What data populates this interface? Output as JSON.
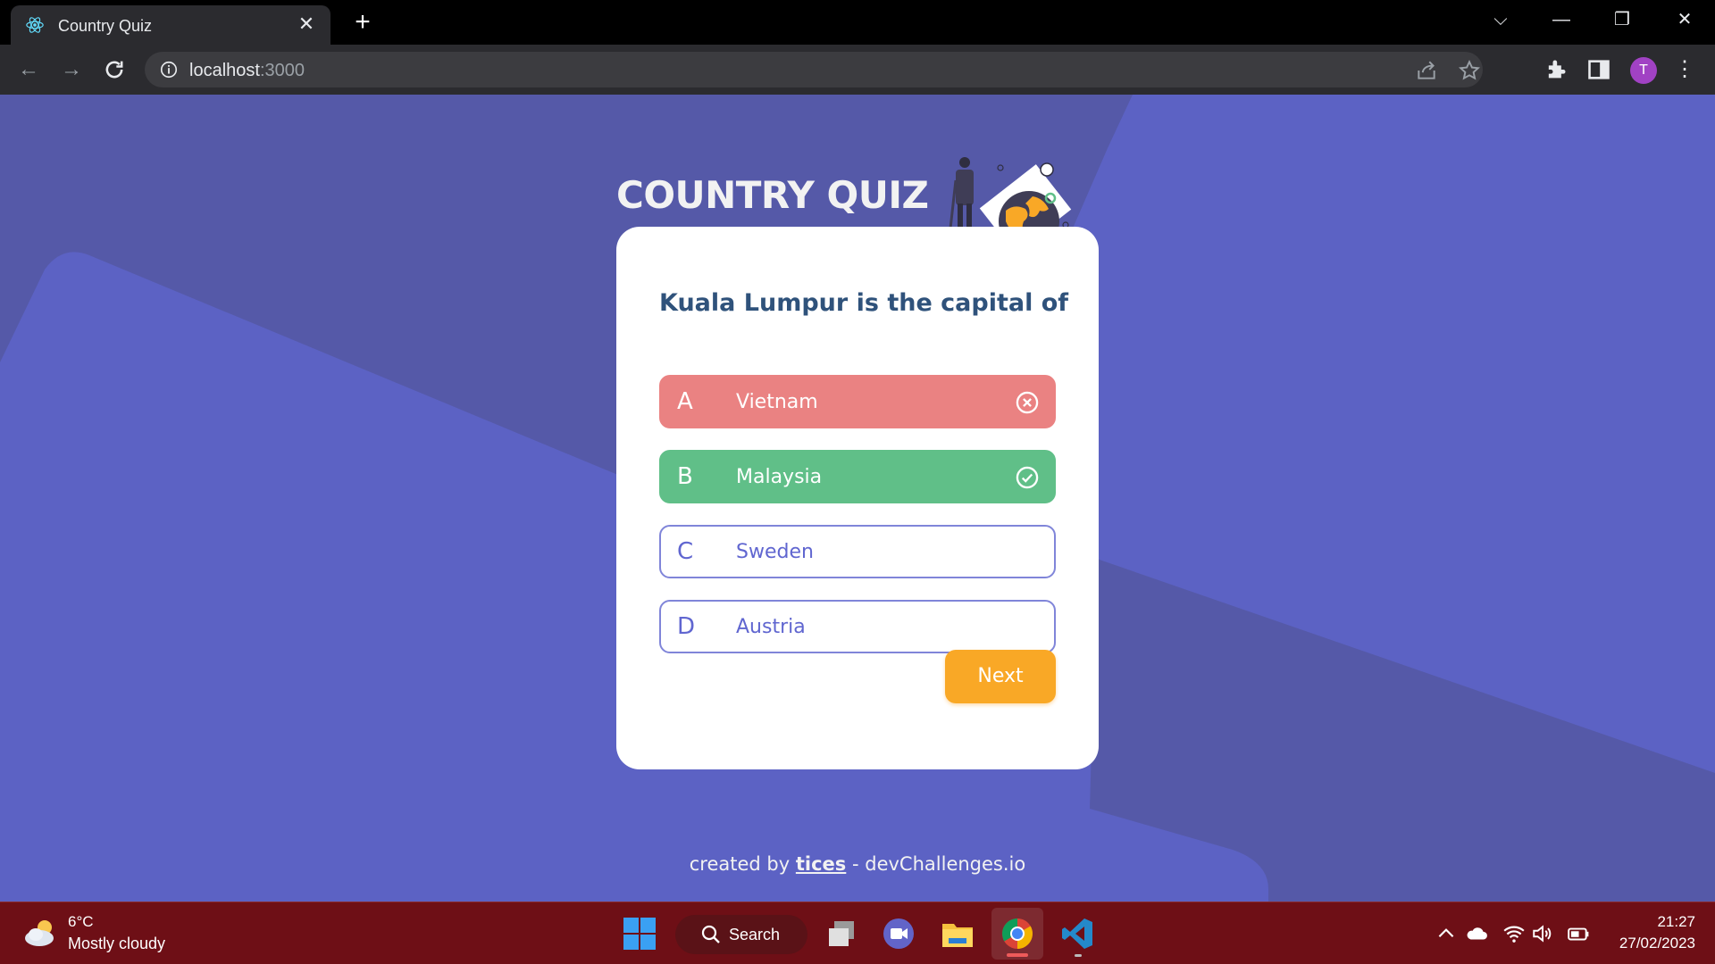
{
  "browser": {
    "tab_title": "Country Quiz",
    "url_host": "localhost",
    "url_port": ":3000",
    "profile_initial": "T"
  },
  "quiz": {
    "title": "COUNTRY QUIZ",
    "question": "Kuala Lumpur is the capital of",
    "options": [
      {
        "letter": "A",
        "text": "Vietnam",
        "state": "wrong"
      },
      {
        "letter": "B",
        "text": "Malaysia",
        "state": "correct"
      },
      {
        "letter": "C",
        "text": "Sweden",
        "state": "default"
      },
      {
        "letter": "D",
        "text": "Austria",
        "state": "default"
      }
    ],
    "next_label": "Next"
  },
  "footer": {
    "prefix": "created by",
    "author": "tices",
    "suffix": "- devChallenges.io"
  },
  "taskbar": {
    "weather_temp": "6°C",
    "weather_desc": "Mostly cloudy",
    "search_label": "Search",
    "time": "21:27",
    "date": "27/02/2023"
  },
  "colors": {
    "background": "#5c62c4",
    "wrong": "#ea8282",
    "correct": "#60bf88",
    "accent": "#f9a826",
    "question": "#2f527b",
    "option_text": "#6066d0",
    "taskbar": "#6e0f16"
  }
}
